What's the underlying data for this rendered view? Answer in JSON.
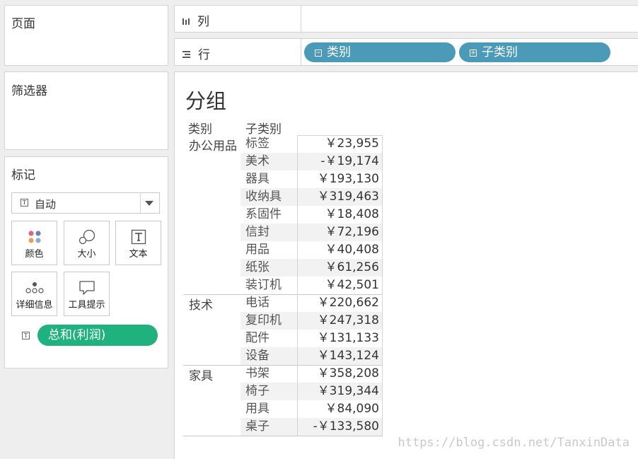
{
  "cards": {
    "pages_title": "页面",
    "filters_title": "筛选器",
    "marks_title": "标记"
  },
  "marks": {
    "mark_type": "自动",
    "buttons": [
      {
        "label": "颜色",
        "icon": "color-dots-icon"
      },
      {
        "label": "大小",
        "icon": "size-circles-icon"
      },
      {
        "label": "文本",
        "icon": "text-t-icon"
      },
      {
        "label": "详细信息",
        "icon": "detail-dots-icon"
      },
      {
        "label": "工具提示",
        "icon": "tooltip-bubble-icon"
      }
    ],
    "field_pill": "总和(利润)"
  },
  "shelves": {
    "columns_label": "列",
    "rows_label": "行",
    "rows_pills": [
      "类别",
      "子类别"
    ]
  },
  "view": {
    "title": "分组",
    "header_category": "类别",
    "header_subcategory": "子类别",
    "groups": [
      {
        "category": "办公用品",
        "rows": [
          {
            "sub": "标签",
            "value": "￥23,955"
          },
          {
            "sub": "美术",
            "value": "-￥19,174"
          },
          {
            "sub": "器具",
            "value": "￥193,130"
          },
          {
            "sub": "收纳具",
            "value": "￥319,463"
          },
          {
            "sub": "系固件",
            "value": "￥18,408"
          },
          {
            "sub": "信封",
            "value": "￥72,196"
          },
          {
            "sub": "用品",
            "value": "￥40,408"
          },
          {
            "sub": "纸张",
            "value": "￥61,256"
          },
          {
            "sub": "装订机",
            "value": "￥42,501"
          }
        ]
      },
      {
        "category": "技术",
        "rows": [
          {
            "sub": "电话",
            "value": "￥220,662"
          },
          {
            "sub": "复印机",
            "value": "￥247,318"
          },
          {
            "sub": "配件",
            "value": "￥131,133"
          },
          {
            "sub": "设备",
            "value": "￥143,124"
          }
        ]
      },
      {
        "category": "家具",
        "rows": [
          {
            "sub": "书架",
            "value": "￥358,208"
          },
          {
            "sub": "椅子",
            "value": "￥319,344"
          },
          {
            "sub": "用具",
            "value": "￥84,090"
          },
          {
            "sub": "桌子",
            "value": "-￥133,580"
          }
        ]
      }
    ]
  },
  "watermark": "https://blog.csdn.net/TanxinData"
}
